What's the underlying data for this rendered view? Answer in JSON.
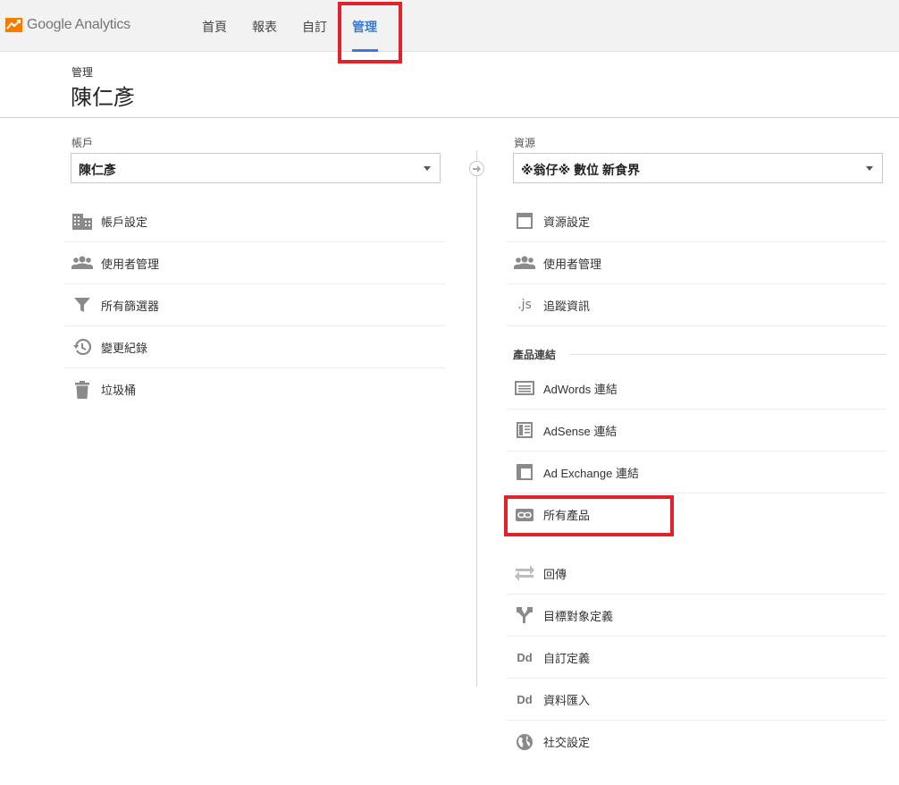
{
  "brand": {
    "name": "Google Analytics"
  },
  "nav": {
    "items": [
      {
        "label": "首頁"
      },
      {
        "label": "報表"
      },
      {
        "label": "自訂"
      },
      {
        "label": "管理"
      }
    ]
  },
  "header": {
    "breadcrumb": "管理",
    "title": "陳仁彥"
  },
  "account": {
    "label": "帳戶",
    "selected": "陳仁彥",
    "items": [
      {
        "label": "帳戶設定",
        "icon": "building-icon"
      },
      {
        "label": "使用者管理",
        "icon": "users-icon"
      },
      {
        "label": "所有篩選器",
        "icon": "filter-icon"
      },
      {
        "label": "變更紀錄",
        "icon": "history-icon"
      },
      {
        "label": "垃圾桶",
        "icon": "trash-icon"
      }
    ]
  },
  "property": {
    "label": "資源",
    "selected": "※翁仔※ 數位 新食界",
    "items": [
      {
        "label": "資源設定",
        "icon": "window-icon"
      },
      {
        "label": "使用者管理",
        "icon": "users-icon"
      },
      {
        "label": "追蹤資訊",
        "icon": "js-icon",
        "icon_text": ".js"
      }
    ],
    "product_links": {
      "heading": "產品連結",
      "items": [
        {
          "label": "AdWords 連結",
          "icon": "adwords-icon"
        },
        {
          "label": "AdSense 連結",
          "icon": "adsense-icon"
        },
        {
          "label": "Ad Exchange 連結",
          "icon": "ad-exchange-icon"
        },
        {
          "label": "所有產品",
          "icon": "link-icon"
        }
      ]
    },
    "more_items": [
      {
        "label": "回傳",
        "icon": "postbacks-icon"
      },
      {
        "label": "目標對象定義",
        "icon": "audience-icon"
      },
      {
        "label": "自訂定義",
        "icon": "dd-icon",
        "icon_text": "Dd"
      },
      {
        "label": "資料匯入",
        "icon": "dd-icon",
        "icon_text": "Dd"
      },
      {
        "label": "社交設定",
        "icon": "globe-icon"
      }
    ]
  },
  "colors": {
    "accent": "#3a7bd5",
    "highlight": "#e0232b",
    "logo": "#f57c00"
  }
}
